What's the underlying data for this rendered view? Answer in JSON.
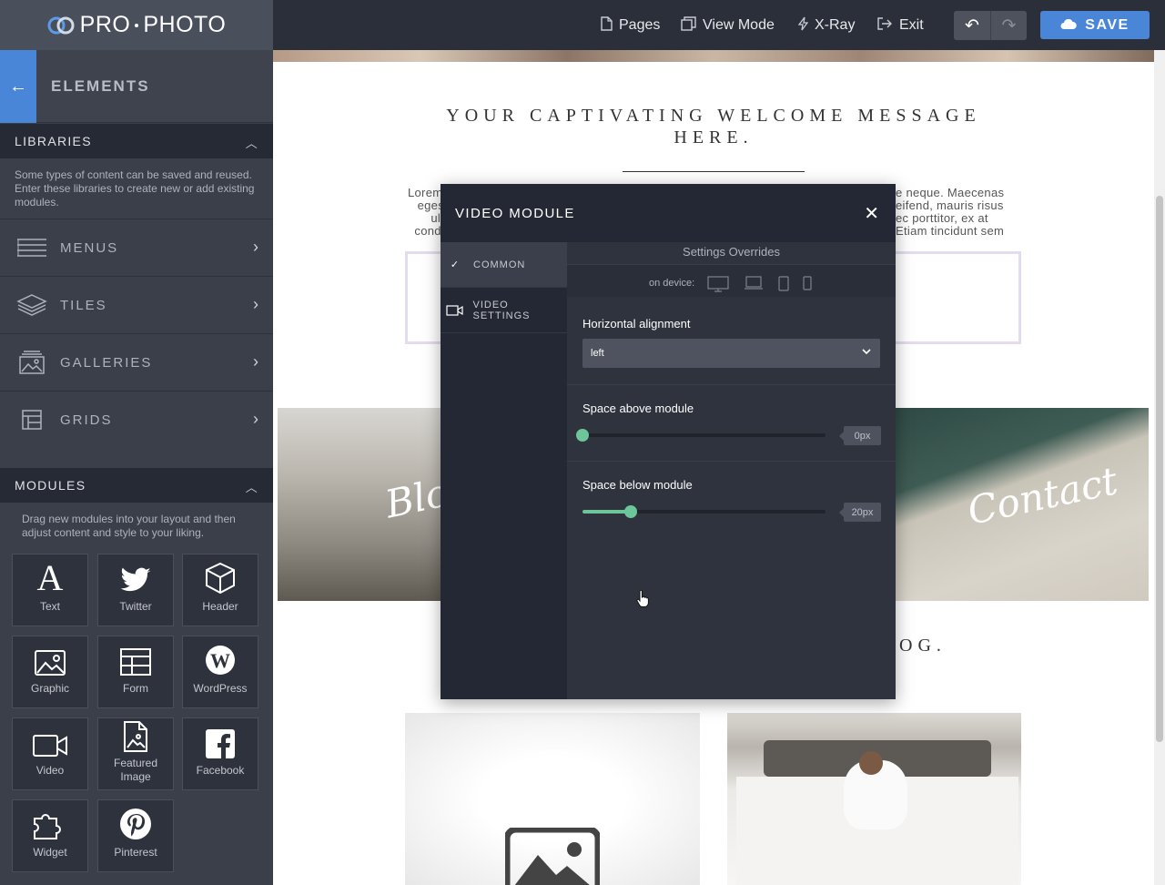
{
  "app": {
    "logo_left": "PRO",
    "logo_right": "PHOTO"
  },
  "topnav": {
    "pages": "Pages",
    "view_mode": "View Mode",
    "xray": "X-Ray",
    "exit": "Exit",
    "save": "SAVE"
  },
  "sidebar": {
    "title": "ELEMENTS",
    "libraries": {
      "heading": "LIBRARIES",
      "description": "Some types of content can be saved and reused. Enter these libraries to create new or add existing modules.",
      "items": [
        {
          "label": "MENUS",
          "icon": "menus-icon"
        },
        {
          "label": "TILES",
          "icon": "tiles-icon"
        },
        {
          "label": "GALLERIES",
          "icon": "galleries-icon"
        },
        {
          "label": "GRIDS",
          "icon": "grids-icon"
        }
      ]
    },
    "modules": {
      "heading": "MODULES",
      "description": "Drag new modules into your layout and then adjust content and style to your liking.",
      "items": [
        {
          "label": "Text",
          "icon": "text-icon"
        },
        {
          "label": "Twitter",
          "icon": "twitter-icon"
        },
        {
          "label": "Header",
          "icon": "header-icon"
        },
        {
          "label": "Graphic",
          "icon": "graphic-icon"
        },
        {
          "label": "Form",
          "icon": "form-icon"
        },
        {
          "label": "WordPress",
          "icon": "wordpress-icon"
        },
        {
          "label": "Video",
          "icon": "video-icon"
        },
        {
          "label": "Featured Image",
          "icon": "featured-image-icon"
        },
        {
          "label": "Facebook",
          "icon": "facebook-icon"
        },
        {
          "label": "Widget",
          "icon": "widget-icon"
        },
        {
          "label": "Pinterest",
          "icon": "pinterest-icon"
        }
      ]
    }
  },
  "page": {
    "welcome": "YOUR CAPTIVATING WELCOME MESSAGE HERE.",
    "lorem_left": [
      "Lorem",
      "eges",
      "ult",
      "condi"
    ],
    "lorem_right": [
      "e neque. Maecenas",
      "eifend, mauris risus",
      "ec porttitor, ex at",
      "Etiam tincidunt sem"
    ],
    "blog_script": "Blog",
    "contact_script": "Contact",
    "blog_heading_tail": "OG."
  },
  "modal": {
    "title": "VIDEO MODULE",
    "tabs": [
      {
        "label": "COMMON",
        "icon": "check-icon",
        "active": true
      },
      {
        "label": "VIDEO SETTINGS",
        "icon": "video-camera-icon",
        "active": false
      }
    ],
    "settings_overrides": "Settings Overrides",
    "on_device": "on device:",
    "horizontal_alignment": {
      "label": "Horizontal alignment",
      "value": "left"
    },
    "space_above": {
      "label": "Space above module",
      "value": "0px",
      "level_percent": 0
    },
    "space_below": {
      "label": "Space below module",
      "value": "20px",
      "level_percent": 20
    }
  },
  "colors": {
    "accent": "#4a86d8",
    "slider": "#6cc69a",
    "sidebar_bg": "#3a3f4a",
    "topbar_bg": "#2b2f3a"
  }
}
